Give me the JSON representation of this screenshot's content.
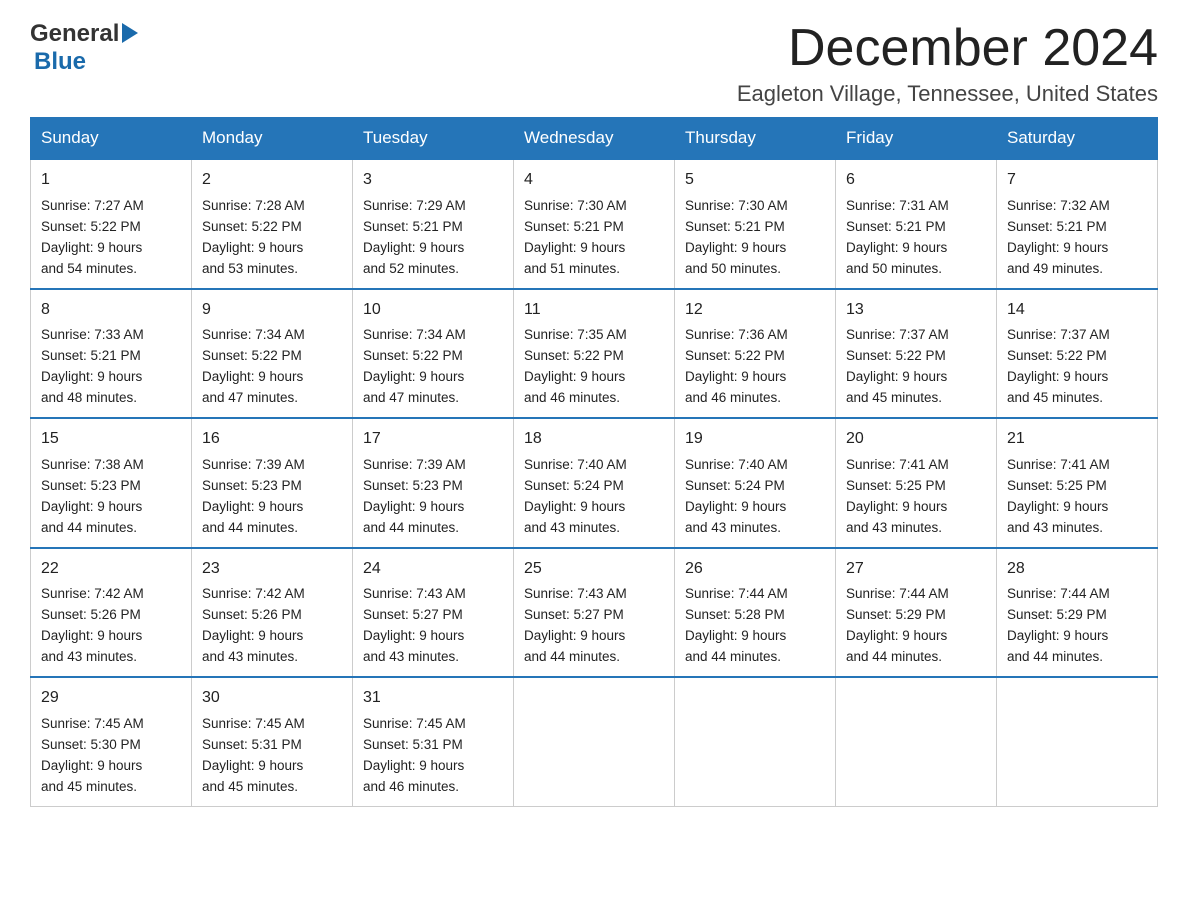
{
  "header": {
    "logo_general": "General",
    "logo_blue": "Blue",
    "main_title": "December 2024",
    "sub_title": "Eagleton Village, Tennessee, United States"
  },
  "days_of_week": [
    "Sunday",
    "Monday",
    "Tuesday",
    "Wednesday",
    "Thursday",
    "Friday",
    "Saturday"
  ],
  "weeks": [
    [
      {
        "day": "1",
        "sunrise": "Sunrise: 7:27 AM",
        "sunset": "Sunset: 5:22 PM",
        "daylight": "Daylight: 9 hours",
        "daylight2": "and 54 minutes."
      },
      {
        "day": "2",
        "sunrise": "Sunrise: 7:28 AM",
        "sunset": "Sunset: 5:22 PM",
        "daylight": "Daylight: 9 hours",
        "daylight2": "and 53 minutes."
      },
      {
        "day": "3",
        "sunrise": "Sunrise: 7:29 AM",
        "sunset": "Sunset: 5:21 PM",
        "daylight": "Daylight: 9 hours",
        "daylight2": "and 52 minutes."
      },
      {
        "day": "4",
        "sunrise": "Sunrise: 7:30 AM",
        "sunset": "Sunset: 5:21 PM",
        "daylight": "Daylight: 9 hours",
        "daylight2": "and 51 minutes."
      },
      {
        "day": "5",
        "sunrise": "Sunrise: 7:30 AM",
        "sunset": "Sunset: 5:21 PM",
        "daylight": "Daylight: 9 hours",
        "daylight2": "and 50 minutes."
      },
      {
        "day": "6",
        "sunrise": "Sunrise: 7:31 AM",
        "sunset": "Sunset: 5:21 PM",
        "daylight": "Daylight: 9 hours",
        "daylight2": "and 50 minutes."
      },
      {
        "day": "7",
        "sunrise": "Sunrise: 7:32 AM",
        "sunset": "Sunset: 5:21 PM",
        "daylight": "Daylight: 9 hours",
        "daylight2": "and 49 minutes."
      }
    ],
    [
      {
        "day": "8",
        "sunrise": "Sunrise: 7:33 AM",
        "sunset": "Sunset: 5:21 PM",
        "daylight": "Daylight: 9 hours",
        "daylight2": "and 48 minutes."
      },
      {
        "day": "9",
        "sunrise": "Sunrise: 7:34 AM",
        "sunset": "Sunset: 5:22 PM",
        "daylight": "Daylight: 9 hours",
        "daylight2": "and 47 minutes."
      },
      {
        "day": "10",
        "sunrise": "Sunrise: 7:34 AM",
        "sunset": "Sunset: 5:22 PM",
        "daylight": "Daylight: 9 hours",
        "daylight2": "and 47 minutes."
      },
      {
        "day": "11",
        "sunrise": "Sunrise: 7:35 AM",
        "sunset": "Sunset: 5:22 PM",
        "daylight": "Daylight: 9 hours",
        "daylight2": "and 46 minutes."
      },
      {
        "day": "12",
        "sunrise": "Sunrise: 7:36 AM",
        "sunset": "Sunset: 5:22 PM",
        "daylight": "Daylight: 9 hours",
        "daylight2": "and 46 minutes."
      },
      {
        "day": "13",
        "sunrise": "Sunrise: 7:37 AM",
        "sunset": "Sunset: 5:22 PM",
        "daylight": "Daylight: 9 hours",
        "daylight2": "and 45 minutes."
      },
      {
        "day": "14",
        "sunrise": "Sunrise: 7:37 AM",
        "sunset": "Sunset: 5:22 PM",
        "daylight": "Daylight: 9 hours",
        "daylight2": "and 45 minutes."
      }
    ],
    [
      {
        "day": "15",
        "sunrise": "Sunrise: 7:38 AM",
        "sunset": "Sunset: 5:23 PM",
        "daylight": "Daylight: 9 hours",
        "daylight2": "and 44 minutes."
      },
      {
        "day": "16",
        "sunrise": "Sunrise: 7:39 AM",
        "sunset": "Sunset: 5:23 PM",
        "daylight": "Daylight: 9 hours",
        "daylight2": "and 44 minutes."
      },
      {
        "day": "17",
        "sunrise": "Sunrise: 7:39 AM",
        "sunset": "Sunset: 5:23 PM",
        "daylight": "Daylight: 9 hours",
        "daylight2": "and 44 minutes."
      },
      {
        "day": "18",
        "sunrise": "Sunrise: 7:40 AM",
        "sunset": "Sunset: 5:24 PM",
        "daylight": "Daylight: 9 hours",
        "daylight2": "and 43 minutes."
      },
      {
        "day": "19",
        "sunrise": "Sunrise: 7:40 AM",
        "sunset": "Sunset: 5:24 PM",
        "daylight": "Daylight: 9 hours",
        "daylight2": "and 43 minutes."
      },
      {
        "day": "20",
        "sunrise": "Sunrise: 7:41 AM",
        "sunset": "Sunset: 5:25 PM",
        "daylight": "Daylight: 9 hours",
        "daylight2": "and 43 minutes."
      },
      {
        "day": "21",
        "sunrise": "Sunrise: 7:41 AM",
        "sunset": "Sunset: 5:25 PM",
        "daylight": "Daylight: 9 hours",
        "daylight2": "and 43 minutes."
      }
    ],
    [
      {
        "day": "22",
        "sunrise": "Sunrise: 7:42 AM",
        "sunset": "Sunset: 5:26 PM",
        "daylight": "Daylight: 9 hours",
        "daylight2": "and 43 minutes."
      },
      {
        "day": "23",
        "sunrise": "Sunrise: 7:42 AM",
        "sunset": "Sunset: 5:26 PM",
        "daylight": "Daylight: 9 hours",
        "daylight2": "and 43 minutes."
      },
      {
        "day": "24",
        "sunrise": "Sunrise: 7:43 AM",
        "sunset": "Sunset: 5:27 PM",
        "daylight": "Daylight: 9 hours",
        "daylight2": "and 43 minutes."
      },
      {
        "day": "25",
        "sunrise": "Sunrise: 7:43 AM",
        "sunset": "Sunset: 5:27 PM",
        "daylight": "Daylight: 9 hours",
        "daylight2": "and 44 minutes."
      },
      {
        "day": "26",
        "sunrise": "Sunrise: 7:44 AM",
        "sunset": "Sunset: 5:28 PM",
        "daylight": "Daylight: 9 hours",
        "daylight2": "and 44 minutes."
      },
      {
        "day": "27",
        "sunrise": "Sunrise: 7:44 AM",
        "sunset": "Sunset: 5:29 PM",
        "daylight": "Daylight: 9 hours",
        "daylight2": "and 44 minutes."
      },
      {
        "day": "28",
        "sunrise": "Sunrise: 7:44 AM",
        "sunset": "Sunset: 5:29 PM",
        "daylight": "Daylight: 9 hours",
        "daylight2": "and 44 minutes."
      }
    ],
    [
      {
        "day": "29",
        "sunrise": "Sunrise: 7:45 AM",
        "sunset": "Sunset: 5:30 PM",
        "daylight": "Daylight: 9 hours",
        "daylight2": "and 45 minutes."
      },
      {
        "day": "30",
        "sunrise": "Sunrise: 7:45 AM",
        "sunset": "Sunset: 5:31 PM",
        "daylight": "Daylight: 9 hours",
        "daylight2": "and 45 minutes."
      },
      {
        "day": "31",
        "sunrise": "Sunrise: 7:45 AM",
        "sunset": "Sunset: 5:31 PM",
        "daylight": "Daylight: 9 hours",
        "daylight2": "and 46 minutes."
      },
      {
        "day": "",
        "sunrise": "",
        "sunset": "",
        "daylight": "",
        "daylight2": ""
      },
      {
        "day": "",
        "sunrise": "",
        "sunset": "",
        "daylight": "",
        "daylight2": ""
      },
      {
        "day": "",
        "sunrise": "",
        "sunset": "",
        "daylight": "",
        "daylight2": ""
      },
      {
        "day": "",
        "sunrise": "",
        "sunset": "",
        "daylight": "",
        "daylight2": ""
      }
    ]
  ]
}
